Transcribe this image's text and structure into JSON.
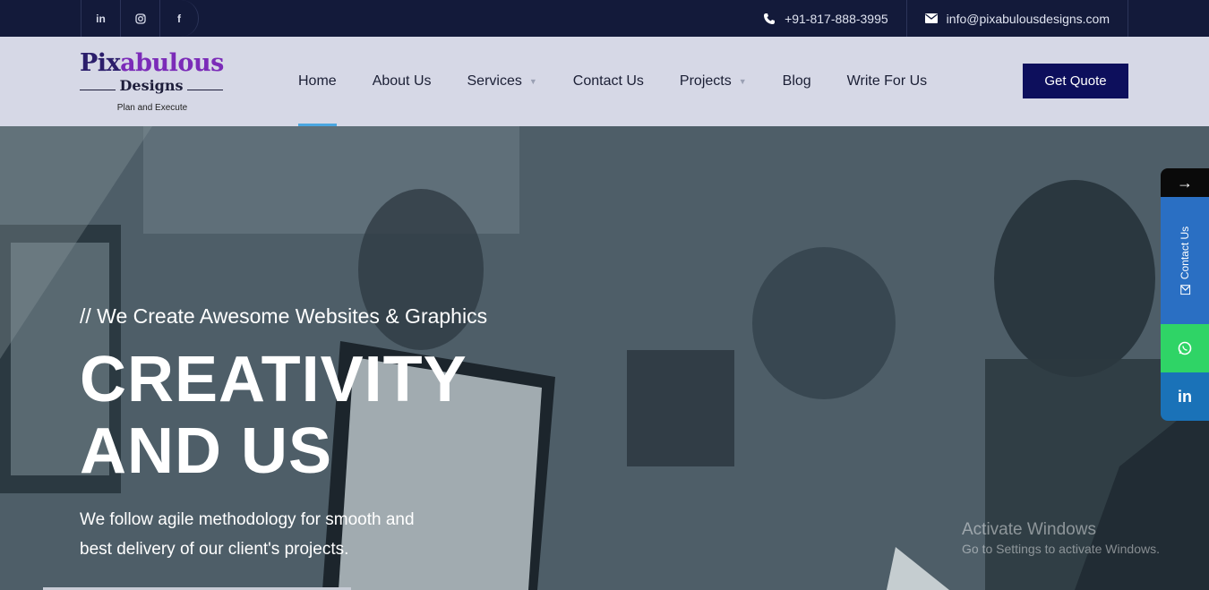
{
  "topbar": {
    "social": [
      {
        "icon": "linkedin-icon",
        "glyph": "in"
      },
      {
        "icon": "instagram-icon",
        "glyph": "◎"
      },
      {
        "icon": "facebook-icon",
        "glyph": "f"
      }
    ],
    "phone": "+91-817-888-3995",
    "email": "info@pixabulousdesigns.com"
  },
  "logo": {
    "line1_a": "Pix",
    "line1_b": "abulous",
    "line2": "Designs",
    "tagline": "Plan and Execute"
  },
  "nav": {
    "items": [
      {
        "label": "Home",
        "active": true
      },
      {
        "label": "About Us"
      },
      {
        "label": "Services",
        "caret": "▼"
      },
      {
        "label": "Contact Us"
      },
      {
        "label": "Projects",
        "caret": "▼"
      },
      {
        "label": "Blog"
      },
      {
        "label": "Write For Us"
      }
    ],
    "cta": "Get Quote"
  },
  "hero": {
    "subtitle": "// We Create Awesome Websites & Graphics",
    "title_line1": "CREATIVITY",
    "title_line2": "AND US",
    "text": "We follow agile methodology for smooth and best delivery of our client's projects."
  },
  "side_widgets": {
    "arrow": "→",
    "contact_label": "Contact Us",
    "whatsapp_icon": "whatsapp-icon",
    "linkedin_glyph": "in"
  },
  "watermark": {
    "line1": "Activate Windows",
    "line2": "Go to Settings to activate Windows."
  },
  "colors": {
    "topbar": "#131a3a",
    "header": "#d6d8e6",
    "cta": "#0d0f5c",
    "nav_active": "#4aa6e0",
    "whatsapp": "#2fd466",
    "contact": "#2a6fc3"
  }
}
